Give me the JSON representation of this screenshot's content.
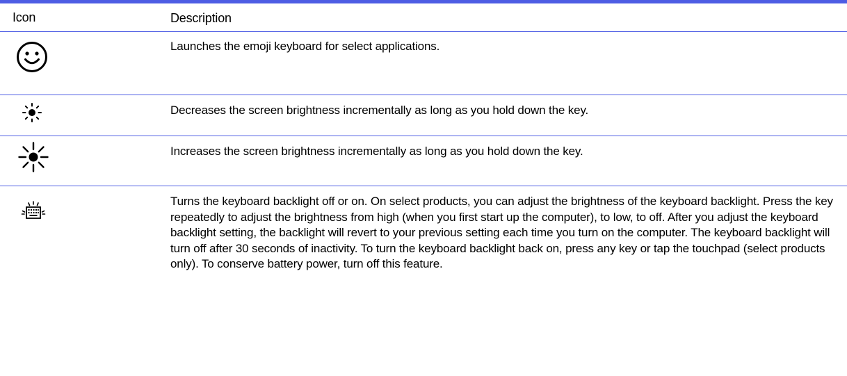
{
  "table": {
    "headers": {
      "icon": "Icon",
      "description": "Description"
    },
    "rows": [
      {
        "icon": "emoji-smiley-icon",
        "description": "Launches the emoji keyboard for select applications."
      },
      {
        "icon": "brightness-down-icon",
        "description": "Decreases the screen brightness incrementally as long as you hold down the key."
      },
      {
        "icon": "brightness-up-icon",
        "description": "Increases the screen brightness incrementally as long as you hold down the key."
      },
      {
        "icon": "keyboard-backlight-icon",
        "description": "Turns the keyboard backlight off or on. On select products, you can adjust the brightness of the keyboard backlight. Press the key repeatedly to adjust the brightness from high (when you first start up the computer), to low, to off. After you adjust the keyboard backlight setting, the backlight will revert to your previous setting each time you turn on the computer. The keyboard backlight will turn off after 30 seconds of inactivity. To turn the keyboard backlight back on, press any key or tap the touchpad (select products only). To conserve battery power, turn off this feature."
      }
    ],
    "colors": {
      "rule": "#4e5de4",
      "text": "#000000"
    }
  }
}
